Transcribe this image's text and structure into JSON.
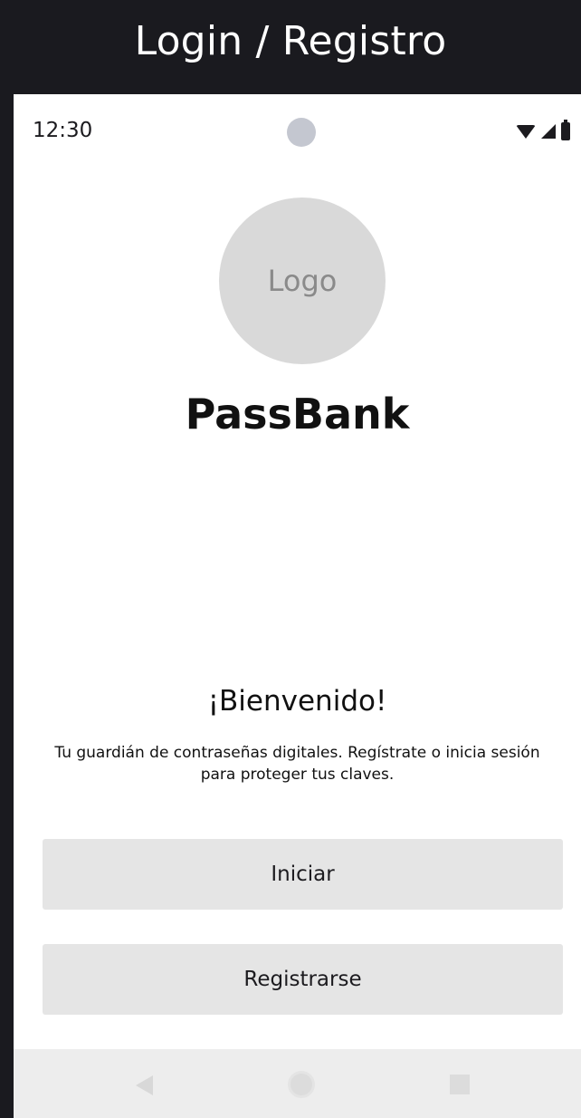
{
  "frame": {
    "title": "Login / Registro"
  },
  "status_bar": {
    "time": "12:30",
    "icons": [
      "wifi-icon",
      "signal-icon",
      "battery-icon"
    ]
  },
  "logo": {
    "placeholder_text": "Logo"
  },
  "app": {
    "name": "PassBank"
  },
  "welcome": {
    "heading": "¡Bienvenido!",
    "tagline": "Tu guardián de contraseñas digitales. Regístrate o inicia sesión para proteger tus claves."
  },
  "actions": {
    "login_label": "Iniciar",
    "register_label": "Registrarse"
  },
  "nav_bar": {
    "icons": [
      "back-icon",
      "home-icon",
      "recents-icon"
    ]
  },
  "colors": {
    "frame_background": "#1a1a1f",
    "screen_background": "#ffffff",
    "button_background": "#e5e5e5",
    "logo_placeholder": "#d9d9d9",
    "nav_bar_background": "#ededed"
  }
}
